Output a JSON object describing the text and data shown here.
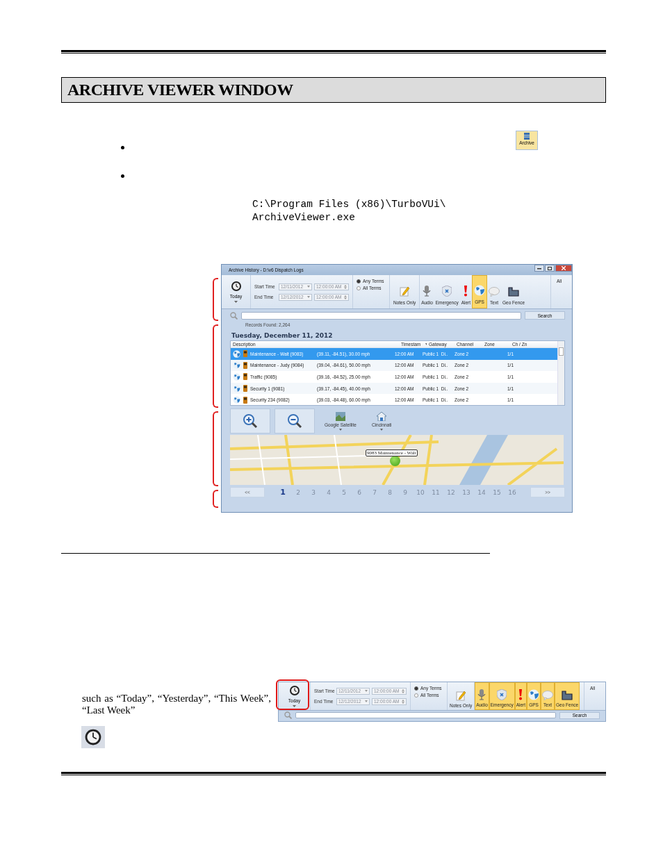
{
  "header": {
    "title": "ARCHIVE VIEWER WINDOW"
  },
  "archive_button": {
    "label": "Archive"
  },
  "install_path": [
    "C:\\Program Files (x86)\\TurboVUi\\",
    "ArchiveViewer.exe"
  ],
  "viewer": {
    "title": "Archive History - D:\\v6 Dispatch Logs",
    "toolbar": {
      "today": {
        "label": "Today"
      },
      "start_label": "Start Time",
      "start_date": "12/11/2012",
      "start_time": "12:00:00 AM",
      "end_label": "End Time",
      "end_date": "12/12/2012",
      "end_time": "12:00:00 AM",
      "terms": [
        {
          "label": "Any Terms",
          "selected": true
        },
        {
          "label": "All Terms",
          "selected": false
        }
      ],
      "filters": [
        {
          "kind": "notes",
          "label": "Notes Only",
          "selected": false
        },
        {
          "kind": "audio",
          "label": "Audio",
          "selected": false
        },
        {
          "kind": "emergency",
          "label": "Emergency",
          "selected": false
        },
        {
          "kind": "alert",
          "label": "Alert",
          "selected": false
        },
        {
          "kind": "gps",
          "label": "GPS",
          "selected": true
        },
        {
          "kind": "text",
          "label": "Text",
          "selected": false
        },
        {
          "kind": "geofence",
          "label": "Geo Fence",
          "selected": false
        }
      ],
      "all_label": "All",
      "search_button": "Search"
    },
    "records": "Records Found:  2,264",
    "date_heading": "Tuesday, December 11, 2012",
    "columns": [
      "Description",
      "Timestam",
      "Gateway",
      "Channel",
      "Zone",
      "Ch / Zn"
    ],
    "rows": [
      {
        "name": "Maintenance - Walt (9083)",
        "location": "(39.11, -84.51), 30.00 mph",
        "time": "12:00 AM",
        "gateway": "Public 1  Di..",
        "channel": "Zone 2",
        "chzn": "1/1",
        "selected": true
      },
      {
        "name": "Maintenance - Judy (9084)",
        "location": "(39.04, -84.61), 50.00 mph",
        "time": "12:00 AM",
        "gateway": "Public 1  Di..",
        "channel": "Zone 2",
        "chzn": "1/1",
        "selected": false
      },
      {
        "name": "Traffic (9085)",
        "location": "(39.16, -84.52), 25.00 mph",
        "time": "12:00 AM",
        "gateway": "Public 1  Di..",
        "channel": "Zone 2",
        "chzn": "1/1",
        "selected": false
      },
      {
        "name": "Security 1 (9081)",
        "location": "(39.17, -84.45), 40.00 mph",
        "time": "12:00 AM",
        "gateway": "Public 1  Di..",
        "channel": "Zone 2",
        "chzn": "1/1",
        "selected": false
      },
      {
        "name": "Security 234 (9082)",
        "location": "(39.03, -84.48), 60.00 mph",
        "time": "12:00 AM",
        "gateway": "Public 1  Di..",
        "channel": "Zone 2",
        "chzn": "1/1",
        "selected": false
      }
    ],
    "map_type": "Google Satellite",
    "map_location": "Cincinnati",
    "marker_label": "9083 Maintenance - Walt",
    "prev": "<<",
    "next": ">>",
    "pages": [
      {
        "label": "1",
        "selected": true
      },
      {
        "label": "2",
        "selected": false
      },
      {
        "label": "3",
        "selected": false
      },
      {
        "label": "4",
        "selected": false
      },
      {
        "label": "5",
        "selected": false
      },
      {
        "label": "6",
        "selected": false
      },
      {
        "label": "7",
        "selected": false
      },
      {
        "label": "8",
        "selected": false
      },
      {
        "label": "9",
        "selected": false
      },
      {
        "label": "10",
        "selected": false
      },
      {
        "label": "11",
        "selected": false
      },
      {
        "label": "12",
        "selected": false
      },
      {
        "label": "13",
        "selected": false
      },
      {
        "label": "14",
        "selected": false
      },
      {
        "label": "15",
        "selected": false
      },
      {
        "label": "16",
        "selected": false
      }
    ]
  },
  "caption": "such as “Today”, “Yesterday”, “This Week”, “Last Week”",
  "example_toolbar": {
    "today": {
      "label": "Today"
    },
    "start_label": "Start Time",
    "start_date": "12/11/2012",
    "start_time": "12:00:00 AM",
    "end_label": "End Time",
    "end_date": "12/12/2012",
    "end_time": "12:00:00 AM",
    "terms": [
      {
        "label": "Any Terms",
        "selected": true
      },
      {
        "label": "All Terms",
        "selected": false
      }
    ],
    "filters": [
      {
        "kind": "notes",
        "label": "Notes Only",
        "selected": false
      },
      {
        "kind": "audio",
        "label": "Audio",
        "selected": true
      },
      {
        "kind": "emergency",
        "label": "Emergency",
        "selected": true
      },
      {
        "kind": "alert",
        "label": "Alert",
        "selected": true
      },
      {
        "kind": "gps",
        "label": "GPS",
        "selected": true
      },
      {
        "kind": "text",
        "label": "Text",
        "selected": true
      },
      {
        "kind": "geofence",
        "label": "Geo Fence",
        "selected": true
      }
    ],
    "all_label": "All",
    "search_button": "Search"
  }
}
